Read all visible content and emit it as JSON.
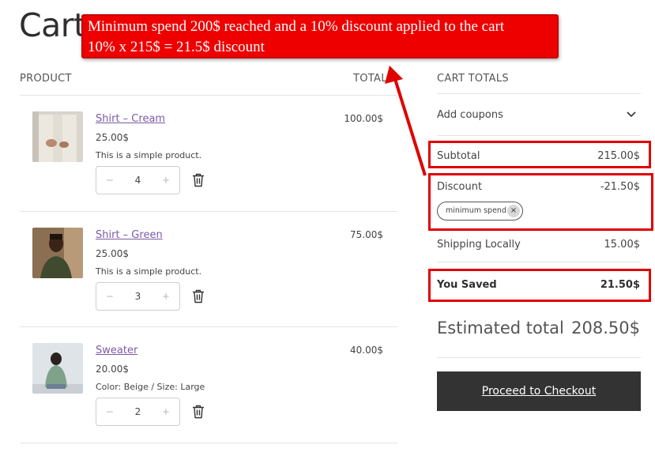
{
  "page": {
    "title": "Cart"
  },
  "annotation": {
    "line1": "Minimum spend 200$ reached and a 10% discount applied to the cart",
    "line2": "10% x 215$ = 21.5$ discount"
  },
  "table": {
    "col_product": "PRODUCT",
    "col_total": "TOTAL"
  },
  "items": [
    {
      "name": "Shirt – Cream",
      "price": "25.00$",
      "description": "This is a simple product.",
      "quantity": "4",
      "total": "100.00$"
    },
    {
      "name": "Shirt – Green",
      "price": "25.00$",
      "description": "This is a simple product.",
      "quantity": "3",
      "total": "75.00$"
    },
    {
      "name": "Sweater",
      "price": "20.00$",
      "description": "Color: Beige / Size: Large",
      "quantity": "2",
      "total": "40.00$"
    }
  ],
  "stepper": {
    "minus": "−",
    "plus": "+"
  },
  "totals": {
    "title": "CART TOTALS",
    "coupons_label": "Add coupons",
    "subtotal_label": "Subtotal",
    "subtotal_value": "215.00$",
    "discount_label": "Discount",
    "discount_value": "-21.50$",
    "coupon_code": "minimum spend",
    "coupon_remove": "×",
    "shipping_label": "Shipping Locally",
    "shipping_value": "15.00$",
    "saved_label": "You Saved",
    "saved_value": "21.50$",
    "estimated_label": "Estimated total",
    "estimated_value": "208.50$"
  },
  "checkout_label": "Proceed to Checkout",
  "colors": {
    "accent_link": "#7b5aa6",
    "highlight_red": "#e00000",
    "checkout_bg": "#333333"
  },
  "icons": {
    "trash": "trash-icon",
    "chevron": "chevron-down-icon",
    "remove": "close-icon"
  }
}
